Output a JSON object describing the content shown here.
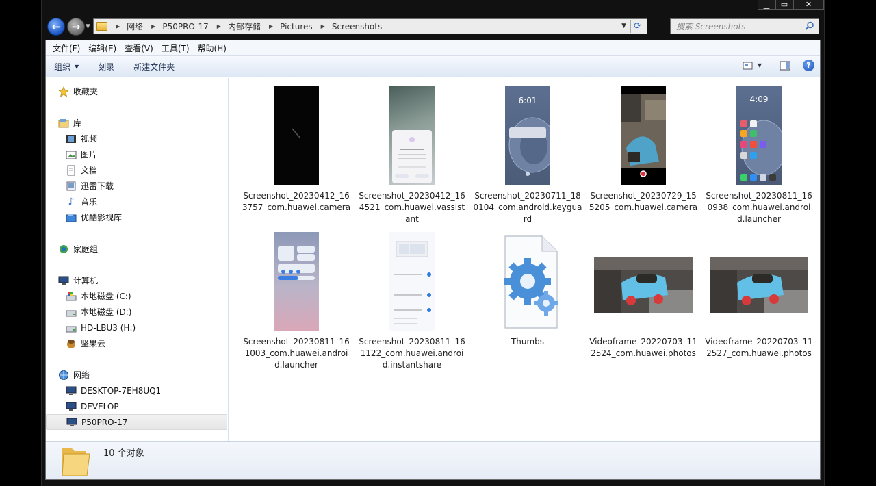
{
  "window": {
    "caption_buttons": [
      "minimize",
      "maximize",
      "close"
    ]
  },
  "address_bar": {
    "breadcrumbs": [
      "网络",
      "P50PRO-17",
      "内部存储",
      "Pictures",
      "Screenshots"
    ]
  },
  "search": {
    "placeholder": "搜索 Screenshots"
  },
  "menubar": [
    "文件(F)",
    "编辑(E)",
    "查看(V)",
    "工具(T)",
    "帮助(H)"
  ],
  "toolbar": {
    "organize": "组织",
    "burn": "刻录",
    "new_folder": "新建文件夹"
  },
  "sidebar": {
    "favorites": "收藏夹",
    "libraries": "库",
    "library_items": [
      "视频",
      "图片",
      "文档",
      "迅雷下载",
      "音乐",
      "优酷影视库"
    ],
    "homegroup": "家庭组",
    "computer": "计算机",
    "drives": [
      "本地磁盘 (C:)",
      "本地磁盘 (D:)",
      "HD-LBU3 (H:)",
      "坚果云"
    ],
    "network": "网络",
    "network_items": [
      "DESKTOP-7EH8UQ1",
      "DEVELOP",
      "P50PRO-17"
    ],
    "selected": "P50PRO-17"
  },
  "files": [
    {
      "name": "Screenshot_20230412_163757_com.huawei.camera",
      "thumb": "black"
    },
    {
      "name": "Screenshot_20230412_164521_com.huawei.vassistant",
      "thumb": "dialog"
    },
    {
      "name": "Screenshot_20230711_180104_com.android.keyguard",
      "thumb": "lockscreen",
      "clock": "6:01"
    },
    {
      "name": "Screenshot_20230729_155205_com.huawei.camera",
      "thumb": "photo"
    },
    {
      "name": "Screenshot_20230811_160938_com.huawei.android.launcher",
      "thumb": "home",
      "clock": "4:09"
    },
    {
      "name": "Screenshot_20230811_161003_com.huawei.android.launcher",
      "thumb": "control"
    },
    {
      "name": "Screenshot_20230811_161122_com.huawei.android.instantshare",
      "thumb": "settings"
    },
    {
      "name": "Thumbs",
      "thumb": "sysfile"
    },
    {
      "name": "Videoframe_20220703_112524_com.huawei.photos",
      "thumb": "car"
    },
    {
      "name": "Videoframe_20220703_112527_com.huawei.photos",
      "thumb": "car"
    }
  ],
  "status": {
    "count": "10 个对象"
  }
}
